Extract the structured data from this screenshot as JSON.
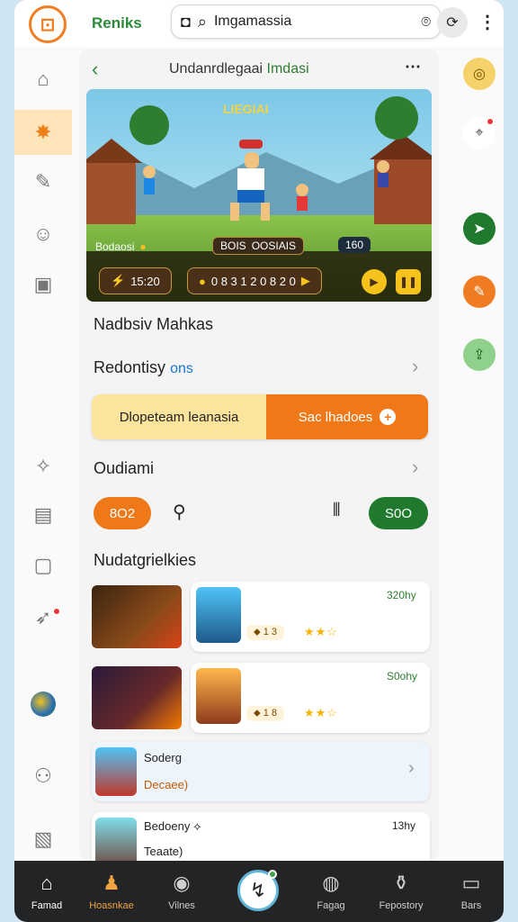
{
  "header": {
    "brand": "Reniks",
    "logo_glyph": "⊡",
    "search_text": "Imgamassia",
    "sync_glyph": "⟳",
    "more_glyph": "⋮"
  },
  "left_nav": [
    {
      "id": "home",
      "glyph": "⌂"
    },
    {
      "id": "active",
      "glyph": "✸"
    },
    {
      "id": "edit",
      "glyph": "✎"
    },
    {
      "id": "emoji",
      "glyph": "☺"
    },
    {
      "id": "bag",
      "glyph": "▣"
    },
    {
      "id": "pin",
      "glyph": "✧"
    },
    {
      "id": "calendar",
      "glyph": "▤"
    },
    {
      "id": "frame",
      "glyph": "▢"
    },
    {
      "id": "rocket",
      "glyph": "➶"
    },
    {
      "id": "avatar",
      "glyph": "●"
    },
    {
      "id": "people",
      "glyph": "⚇"
    },
    {
      "id": "doc",
      "glyph": "▧"
    }
  ],
  "right_rail": [
    {
      "id": "yellow",
      "glyph": "◎",
      "color": "#f6d36a"
    },
    {
      "id": "tag",
      "glyph": "⌖",
      "color": "#ffffff"
    },
    {
      "id": "green",
      "glyph": "➤",
      "color": "#1f7a2e"
    },
    {
      "id": "orange",
      "glyph": "✎",
      "color": "#ef7c22"
    },
    {
      "id": "lightgreen",
      "glyph": "⇪",
      "color": "#8fd18a"
    }
  ],
  "panel": {
    "back_glyph": "‹",
    "title": "Undanrdlegaai",
    "title_accent": "Imdasi",
    "more_glyph": "⋯",
    "banner": {
      "title": "LIEGIAI",
      "hud_left": "Bodaosi",
      "hud_center": "BOIS",
      "hud_center_2": "OOSIAIS",
      "hud_right": "160",
      "score_left": "15:20",
      "score_center": "0 8 3 1  2 0 8 2 0"
    },
    "section1": "Nadbsiv Mahkas",
    "section2_a": "Redontisy",
    "section2_b": "ons",
    "toggle_left": "Dlopeteam leanasia",
    "toggle_right": "Sac lhadoes",
    "section3": "Oudiami",
    "pill_orange": "8O2",
    "pill_green": "S0O",
    "section4": "Nudatgrielkies",
    "rows": [
      {
        "badge": "⬥ 1 3",
        "meta": "320hy"
      },
      {
        "badge": "⬥ 1 8",
        "meta": "S0ohy"
      },
      {
        "title": "Soderg",
        "subtitle": "Decaee)"
      },
      {
        "title": "Bedoeny",
        "subtitle": "Teaate)",
        "meta": "13hy"
      }
    ]
  },
  "bottom_nav": [
    {
      "id": "home",
      "label": "Famad",
      "glyph": "⌂"
    },
    {
      "id": "hoosanko",
      "label": "Hoasnkae",
      "glyph": "♟"
    },
    {
      "id": "vision",
      "label": "Vilnes",
      "glyph": "◉"
    },
    {
      "id": "fab",
      "label": "",
      "glyph": "↯"
    },
    {
      "id": "feeds",
      "label": "Fagag",
      "glyph": "◍"
    },
    {
      "id": "repository",
      "label": "Fepostory",
      "glyph": "⚱"
    },
    {
      "id": "bars",
      "label": "Bars",
      "glyph": "▭"
    }
  ]
}
